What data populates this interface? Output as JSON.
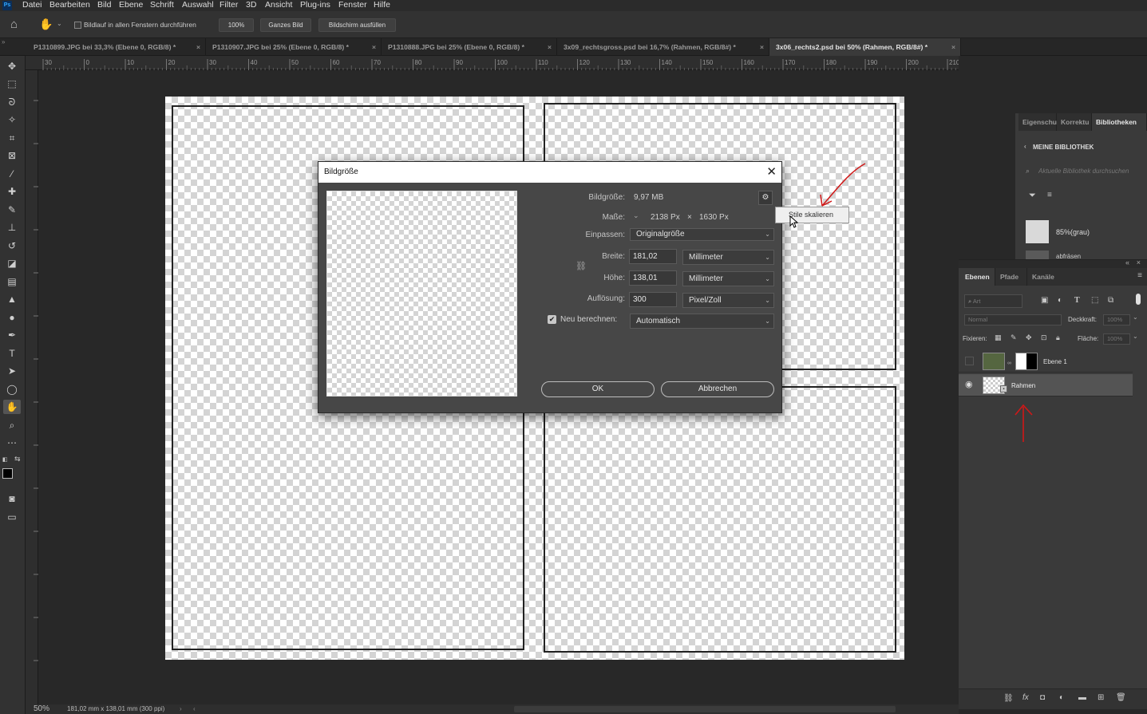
{
  "menubar": {
    "app_icon": "Ps",
    "items": [
      "Datei",
      "Bearbeiten",
      "Bild",
      "Ebene",
      "Schrift",
      "Auswahl",
      "Filter",
      "3D",
      "Ansicht",
      "Plug-ins",
      "Fenster",
      "Hilfe"
    ]
  },
  "options": {
    "scroll_all_label": "Bildlauf in allen Fenstern durchführen",
    "zoom_100": "100%",
    "fit_screen": "Ganzes Bild",
    "fill_screen": "Bildschirm ausfüllen"
  },
  "tabs": [
    {
      "label": "P1310899.JPG bei 33,3% (Ebene 0, RGB/8) *",
      "active": false
    },
    {
      "label": "P1310907.JPG bei 25% (Ebene 0, RGB/8) *",
      "active": false
    },
    {
      "label": "P1310888.JPG bei 25% (Ebene 0, RGB/8) *",
      "active": false
    },
    {
      "label": "3x09_rechtsgross.psd bei 16,7% (Rahmen, RGB/8#) *",
      "active": false
    },
    {
      "label": "3x06_rechts2.psd bei 50% (Rahmen, RGB/8#) *",
      "active": true
    }
  ],
  "ruler_h_labels": [
    "30",
    "0",
    "10",
    "20",
    "30",
    "40",
    "50",
    "60",
    "70",
    "80",
    "90",
    "100",
    "110",
    "120",
    "130",
    "140",
    "150",
    "160",
    "170",
    "180",
    "190",
    "200",
    "210",
    "220",
    "230"
  ],
  "status": {
    "zoom": "50%",
    "doc_info": "181,02 mm x 138,01 mm (300 ppi)"
  },
  "dialog": {
    "title": "Bildgröße",
    "size_label": "Bildgröße:",
    "size_value": "9,97 MB",
    "dims_label": "Maße:",
    "dims_width": "2138 Px",
    "dims_x": "×",
    "dims_height": "1630 Px",
    "fit_label": "Einpassen:",
    "fit_value": "Originalgröße",
    "width_label": "Breite:",
    "width_value": "181,02",
    "width_unit": "Millimeter",
    "height_label": "Höhe:",
    "height_value": "138,01",
    "height_unit": "Millimeter",
    "resolution_label": "Auflösung:",
    "resolution_value": "300",
    "resolution_unit": "Pixel/Zoll",
    "resample_label": "Neu berechnen:",
    "resample_checked": true,
    "resample_value": "Automatisch",
    "ok_label": "OK",
    "cancel_label": "Abbrechen",
    "tooltip": "Stile skalieren"
  },
  "library_panel": {
    "tabs": [
      "Eigenschaften",
      "Korrekturen",
      "Bibliotheken"
    ],
    "tab_display": [
      "Eigenschu",
      "Korrektu",
      "Bibliotheken"
    ],
    "header": "MEINE BIBLIOTHEK",
    "search_placeholder": "Aktuelle Bibliothek durchsuchen",
    "swatch_label": "85%(grau)",
    "swatch2_label": "abfräsen"
  },
  "layers_panel": {
    "tabs": [
      "Ebenen",
      "Pfade",
      "Kanäle"
    ],
    "filter_placeholder": "Art",
    "blend_mode": "Normal",
    "opacity_label": "Deckkraft:",
    "opacity_value": "100%",
    "lock_label": "Fixieren:",
    "fill_label": "Fläche:",
    "fill_value": "100%",
    "layers": [
      {
        "name": "Ebene 1",
        "visible": false,
        "selected": false
      },
      {
        "name": "Rahmen",
        "visible": true,
        "selected": true
      }
    ]
  },
  "colors": {
    "accent_blue": "#31a8ff",
    "annotation_red": "#d01818"
  }
}
